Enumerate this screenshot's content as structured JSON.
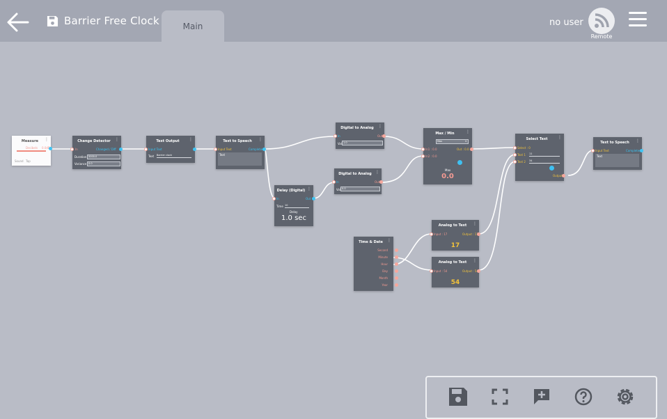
{
  "header": {
    "title": "Barrier Free Clock",
    "tab": "Main",
    "user": "no user",
    "remote_label": "Remote"
  },
  "nodes": {
    "measure": {
      "title": "Measure",
      "label_out": "Decibels",
      "value": "0.0dB",
      "bottom_left": "Sound",
      "bottom_right": "Tap"
    },
    "change_detector": {
      "title": "Change Detector",
      "in": "In",
      "out": "Changed / Diff",
      "field1_label": "Duration",
      "field1": "5000.0",
      "field2_label": "Variance",
      "field2": "0.0"
    },
    "text_output": {
      "title": "Text Output",
      "in": "Input Text",
      "field_label": "Text",
      "field": "Barrier clock"
    },
    "tts1": {
      "title": "Text to Speech",
      "in": "Input Text",
      "out": "Completed",
      "area": "Text"
    },
    "delay": {
      "title": "Delay (Digital)",
      "in": "In",
      "out": "Out",
      "field_label": "Time",
      "field": "10",
      "caption": "Delay",
      "value": "1.0 sec"
    },
    "d2a_1": {
      "title": "Digital to Analog",
      "in": "In",
      "out": "Out",
      "field_label": "Val",
      "field": "1.0"
    },
    "d2a_2": {
      "title": "Digital to Analog",
      "in": "In",
      "out": "Out",
      "field_label": "Val",
      "field": "0.0"
    },
    "maxmin": {
      "title": "Max / Min",
      "select": "Max",
      "in1": "In1 : 0.0",
      "in2": "In2 : 0.0",
      "out": "Out : 0.0",
      "caption": "Max",
      "value": "0.0"
    },
    "select_text": {
      "title": "Select Text",
      "in0": "Select : 0",
      "in1": "Text 1",
      "in1_field": "11",
      "in2": "Text 2",
      "in2_field": "34",
      "out": "Output"
    },
    "tts2": {
      "title": "Text to Speech",
      "in": "Input Text",
      "out": "Completed",
      "area": "Text"
    },
    "time_date": {
      "title": "Time & Date",
      "outputs": [
        "Second",
        "Minute",
        "Hour",
        "Day",
        "Month",
        "Year"
      ]
    },
    "a2t_1": {
      "title": "Analog to Text",
      "in": "Input : 17",
      "out": "Output : 17",
      "value": "17"
    },
    "a2t_2": {
      "title": "Analog to Text",
      "in": "Input : 54",
      "out": "Output : 54",
      "value": "54"
    }
  },
  "toolbar": {
    "icons": [
      "save-icon",
      "fullscreen-icon",
      "add-comment-icon",
      "help-icon",
      "settings-icon"
    ]
  },
  "colors": {
    "canvas": "#b9bcc6",
    "topbar": "#a3a7b3",
    "node": "#5e636d",
    "input_port": "#f6a79d",
    "output_port": "#40c4f3",
    "value_yellow": "#f2c23a",
    "value_pink": "#f59b93"
  }
}
